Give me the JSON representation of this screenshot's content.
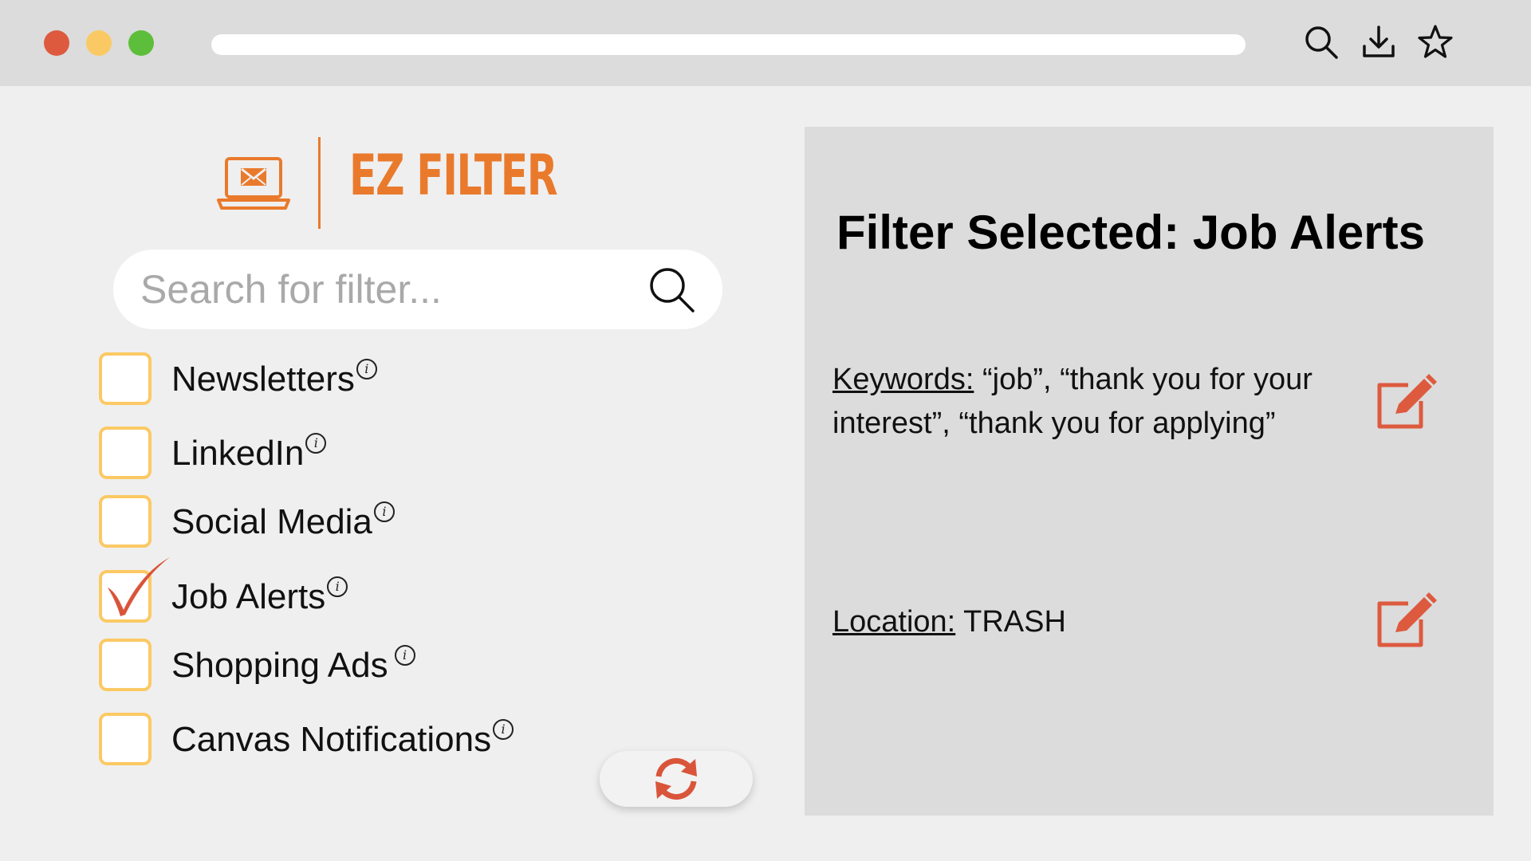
{
  "browser": {
    "icons": [
      "search-icon",
      "download-icon",
      "star-icon"
    ]
  },
  "app": {
    "name": "EZ FILTER",
    "logo_icon": "laptop-mail-icon",
    "accent_color": "#e97a2c"
  },
  "search": {
    "placeholder": "Search for filter...",
    "value": ""
  },
  "filters": [
    {
      "label": "Newsletters",
      "checked": false
    },
    {
      "label": "LinkedIn",
      "checked": false
    },
    {
      "label": "Social Media",
      "checked": false
    },
    {
      "label": "Job Alerts",
      "checked": true
    },
    {
      "label": "Shopping Ads",
      "checked": false
    },
    {
      "label": "Canvas Notifications",
      "checked": false
    }
  ],
  "info_glyph": "i",
  "refresh_icon": "refresh-icon",
  "detail_panel": {
    "title": "Filter Selected: Job Alerts",
    "keywords_label": "Keywords:",
    "keywords_value": "“job”, “thank you for your interest”, “thank you for applying”",
    "location_label": "Location:",
    "location_value": "TRASH",
    "edit_icon": "edit-icon"
  },
  "colors": {
    "checkbox_border": "#fbc964",
    "check_mark": "#d9553a",
    "edit_icon": "#dd5a3f"
  }
}
